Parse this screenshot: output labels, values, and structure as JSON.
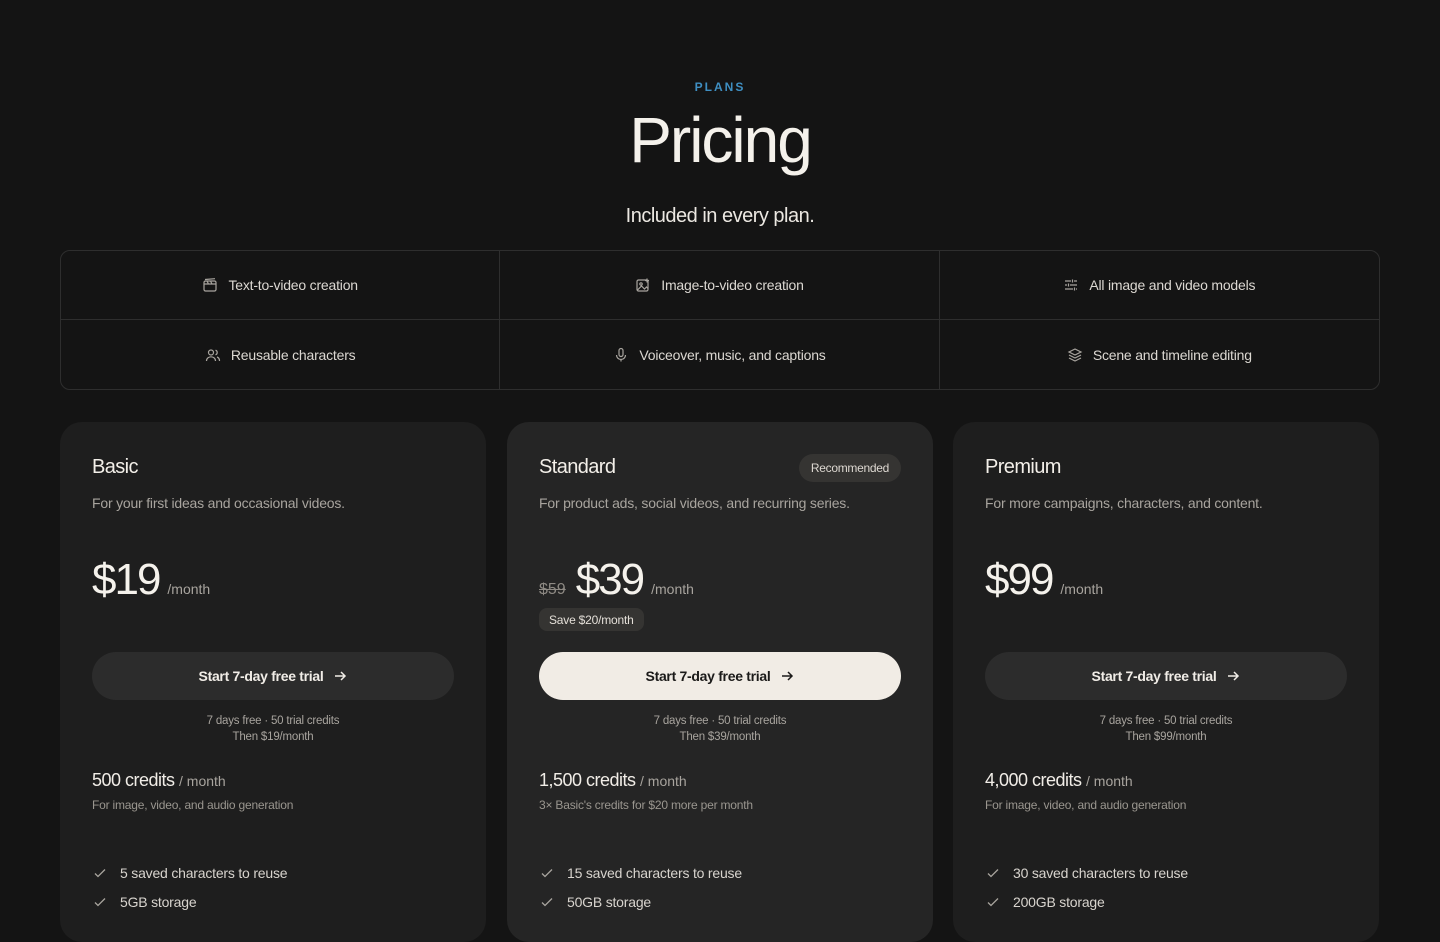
{
  "header": {
    "eyebrow": "PLANS",
    "title": "Pricing",
    "subtitle": "Included in every plan."
  },
  "features": [
    {
      "label": "Text-to-video creation",
      "icon": "clapperboard-icon"
    },
    {
      "label": "Image-to-video creation",
      "icon": "image-plus-icon"
    },
    {
      "label": "All image and video models",
      "icon": "sliders-icon"
    },
    {
      "label": "Reusable characters",
      "icon": "users-icon"
    },
    {
      "label": "Voiceover, music, and captions",
      "icon": "microphone-icon"
    },
    {
      "label": "Scene and timeline editing",
      "icon": "layers-icon"
    }
  ],
  "plans": [
    {
      "name": "Basic",
      "description": "For your first ideas and occasional videos.",
      "price": "$19",
      "per": "/month",
      "cta": "Start 7-day free trial",
      "trial_line1": "7 days free · 50 trial credits",
      "trial_line2": "Then $19/month",
      "credits": "500 credits",
      "credits_per": "/ month",
      "credits_note": "For image, video, and audio generation",
      "items": [
        "5 saved characters to reuse",
        "5GB storage"
      ]
    },
    {
      "name": "Standard",
      "badge": "Recommended",
      "description": "For product ads, social videos, and recurring series.",
      "old_price": "$59",
      "price": "$39",
      "per": "/month",
      "save": "Save $20/month",
      "cta": "Start 7-day free trial",
      "trial_line1": "7 days free · 50 trial credits",
      "trial_line2": "Then $39/month",
      "credits": "1,500 credits",
      "credits_per": "/ month",
      "credits_note": "3× Basic's credits for $20 more per month",
      "items": [
        "15 saved characters to reuse",
        "50GB storage"
      ]
    },
    {
      "name": "Premium",
      "description": "For more campaigns, characters, and content.",
      "price": "$99",
      "per": "/month",
      "cta": "Start 7-day free trial",
      "trial_line1": "7 days free · 50 trial credits",
      "trial_line2": "Then $99/month",
      "credits": "4,000 credits",
      "credits_per": "/ month",
      "credits_note": "For image, video, and audio generation",
      "items": [
        "30 saved characters to reuse",
        "200GB storage"
      ]
    }
  ],
  "colors": {
    "background": "#141414",
    "accent": "#3f8fc2",
    "card": "#1e1e1e",
    "card_featured": "#252525",
    "cta_featured": "#f1ece5"
  }
}
